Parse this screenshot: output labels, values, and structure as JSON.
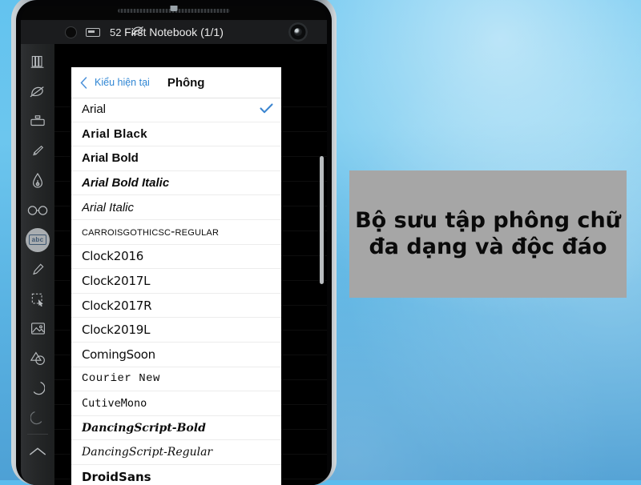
{
  "background": {
    "sky_top": "#63c3ef",
    "sky_bottom": "#4c9ed3"
  },
  "phone": {
    "statusbar": {
      "record_icon": "record-dot-icon",
      "battery_icon": "battery-icon",
      "battery_level": "52",
      "pen_icon": "pen-tip-icon",
      "title": "First Notebook (1/1)",
      "camera_icon": "front-camera-icon"
    },
    "toolbar": {
      "items": [
        {
          "name": "books-icon",
          "label": "Books"
        },
        {
          "name": "pen-icon",
          "label": "Pen"
        },
        {
          "name": "eraser-icon",
          "label": "Eraser"
        },
        {
          "name": "marker-icon",
          "label": "Marker"
        },
        {
          "name": "fountain-pen-icon",
          "label": "Fountain Pen"
        },
        {
          "name": "glasses-icon",
          "label": "Glasses"
        },
        {
          "name": "text-abc-icon",
          "label": "abc",
          "selected": true
        },
        {
          "name": "highlighter-icon",
          "label": "Highlighter"
        },
        {
          "name": "lasso-select-icon",
          "label": "Select"
        },
        {
          "name": "image-icon",
          "label": "Image"
        },
        {
          "name": "shapes-icon",
          "label": "Shapes"
        },
        {
          "name": "undo-icon",
          "label": "Undo"
        },
        {
          "name": "redo-icon",
          "label": "Redo"
        },
        {
          "name": "collapse-chevron-icon",
          "label": "Collapse"
        }
      ]
    },
    "panel": {
      "back_icon": "back-chevron-icon",
      "back_label": "Kiểu hiện tại",
      "title": "Phông",
      "check_icon": "check-icon",
      "accent_color": "#3b85d0",
      "link_color": "#2f86d4",
      "fonts": [
        {
          "name": "Arial",
          "style": "f-sans",
          "selected": true
        },
        {
          "name": "Arial Black",
          "style": "f-black",
          "selected": false
        },
        {
          "name": "Arial Bold",
          "style": "f-bold",
          "selected": false
        },
        {
          "name": "Arial Bold Italic",
          "style": "f-bolditalic",
          "selected": false
        },
        {
          "name": "Arial Italic",
          "style": "f-italic",
          "selected": false
        },
        {
          "name": "CarroisGothicSC-Regular",
          "style": "f-smallcaps",
          "selected": false
        },
        {
          "name": "Clock2016",
          "style": "f-clock",
          "selected": false
        },
        {
          "name": "Clock2017L",
          "style": "f-clock",
          "selected": false
        },
        {
          "name": "Clock2017R",
          "style": "f-clock",
          "selected": false
        },
        {
          "name": "Clock2019L",
          "style": "f-clock",
          "selected": false
        },
        {
          "name": "ComingSoon",
          "style": "f-coming",
          "selected": false
        },
        {
          "name": "Courier New",
          "style": "f-mono",
          "selected": false
        },
        {
          "name": "CutiveMono",
          "style": "f-cutive",
          "selected": false
        },
        {
          "name": "DancingScript-Bold",
          "style": "f-scriptb",
          "selected": false
        },
        {
          "name": "DancingScript-Regular",
          "style": "f-script",
          "selected": false
        },
        {
          "name": "DroidSans",
          "style": "f-droid",
          "selected": false
        }
      ]
    }
  },
  "caption": {
    "background_color": "#a6a6a6",
    "line1": "Bộ sưu tập phông chữ",
    "line2": "đa dạng và độc đáo"
  }
}
